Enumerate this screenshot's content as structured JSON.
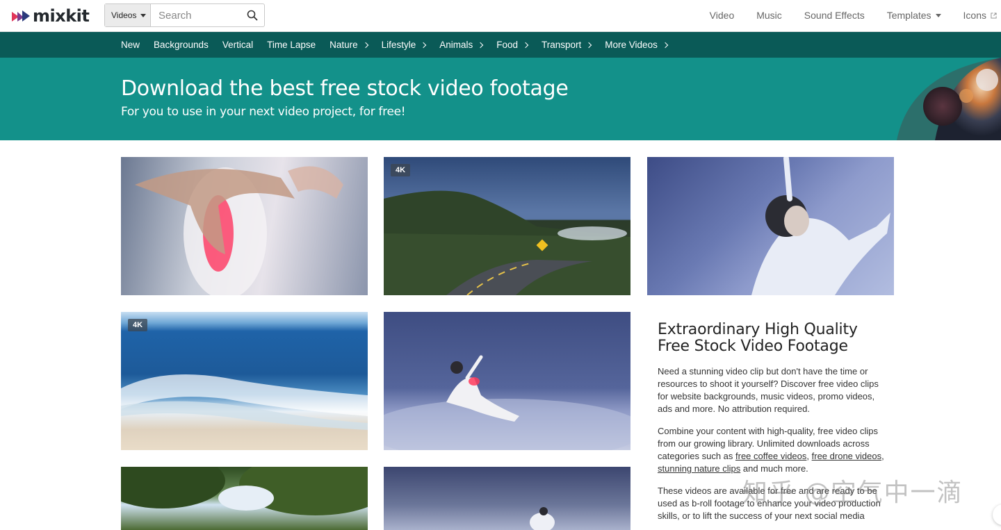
{
  "brand": {
    "name": "mixkit",
    "colors": {
      "teal_dark": "#0a5a57",
      "teal": "#13918a",
      "logo_red": "#e2365b",
      "logo_blue": "#2a3a7b"
    }
  },
  "search": {
    "category": "Videos",
    "placeholder": "Search",
    "icon": "search-icon"
  },
  "topnav": [
    {
      "label": "Video"
    },
    {
      "label": "Music"
    },
    {
      "label": "Sound Effects"
    },
    {
      "label": "Templates"
    },
    {
      "label": "Icons"
    }
  ],
  "categories": [
    {
      "label": "New"
    },
    {
      "label": "Backgrounds"
    },
    {
      "label": "Vertical"
    },
    {
      "label": "Time Lapse"
    },
    {
      "label": "Nature"
    },
    {
      "label": "Lifestyle"
    },
    {
      "label": "Animals"
    },
    {
      "label": "Food"
    },
    {
      "label": "Transport"
    },
    {
      "label": "More Videos"
    }
  ],
  "hero": {
    "title": "Download the best free stock video footage",
    "subtitle": "For you to use in your next video project, for free!"
  },
  "thumbnails": [
    {
      "badge": ""
    },
    {
      "badge": "4K"
    },
    {
      "badge": ""
    },
    {
      "badge": "4K"
    },
    {
      "badge": ""
    }
  ],
  "side": {
    "title": "Extraordinary High Quality Free Stock Video Footage",
    "p1": "Need a stunning video clip but don't have the time or resources to shoot it yourself? Discover free video clips for website backgrounds, music videos, promo videos, ads and more. No attribution required.",
    "p2_prefix": "Combine your content with high-quality, free video clips from our growing library. Unlimited downloads across categories such as ",
    "link_coffee": "free coffee videos",
    "link_drone": "free drone videos",
    "link_nature": "stunning nature clips",
    "p2_suffix": " and much more.",
    "p3": "These videos are available for free and are ready to be used as b-roll footage to enhance your video production skills, or to lift the success of your next social media"
  },
  "watermark": "知乎 @空气中一滴"
}
